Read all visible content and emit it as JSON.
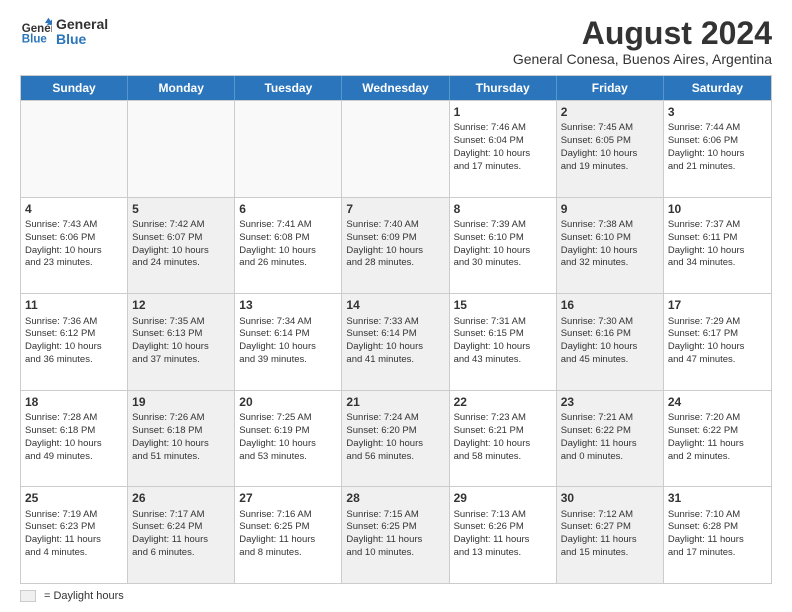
{
  "logo": {
    "line1": "General",
    "line2": "Blue"
  },
  "title": "August 2024",
  "subtitle": "General Conesa, Buenos Aires, Argentina",
  "days_of_week": [
    "Sunday",
    "Monday",
    "Tuesday",
    "Wednesday",
    "Thursday",
    "Friday",
    "Saturday"
  ],
  "weeks": [
    [
      {
        "day": "",
        "empty": true,
        "shaded": false,
        "lines": []
      },
      {
        "day": "",
        "empty": true,
        "shaded": false,
        "lines": []
      },
      {
        "day": "",
        "empty": true,
        "shaded": false,
        "lines": []
      },
      {
        "day": "",
        "empty": true,
        "shaded": false,
        "lines": []
      },
      {
        "day": "1",
        "empty": false,
        "shaded": false,
        "lines": [
          "Sunrise: 7:46 AM",
          "Sunset: 6:04 PM",
          "Daylight: 10 hours",
          "and 17 minutes."
        ]
      },
      {
        "day": "2",
        "empty": false,
        "shaded": true,
        "lines": [
          "Sunrise: 7:45 AM",
          "Sunset: 6:05 PM",
          "Daylight: 10 hours",
          "and 19 minutes."
        ]
      },
      {
        "day": "3",
        "empty": false,
        "shaded": false,
        "lines": [
          "Sunrise: 7:44 AM",
          "Sunset: 6:06 PM",
          "Daylight: 10 hours",
          "and 21 minutes."
        ]
      }
    ],
    [
      {
        "day": "4",
        "empty": false,
        "shaded": false,
        "lines": [
          "Sunrise: 7:43 AM",
          "Sunset: 6:06 PM",
          "Daylight: 10 hours",
          "and 23 minutes."
        ]
      },
      {
        "day": "5",
        "empty": false,
        "shaded": true,
        "lines": [
          "Sunrise: 7:42 AM",
          "Sunset: 6:07 PM",
          "Daylight: 10 hours",
          "and 24 minutes."
        ]
      },
      {
        "day": "6",
        "empty": false,
        "shaded": false,
        "lines": [
          "Sunrise: 7:41 AM",
          "Sunset: 6:08 PM",
          "Daylight: 10 hours",
          "and 26 minutes."
        ]
      },
      {
        "day": "7",
        "empty": false,
        "shaded": true,
        "lines": [
          "Sunrise: 7:40 AM",
          "Sunset: 6:09 PM",
          "Daylight: 10 hours",
          "and 28 minutes."
        ]
      },
      {
        "day": "8",
        "empty": false,
        "shaded": false,
        "lines": [
          "Sunrise: 7:39 AM",
          "Sunset: 6:10 PM",
          "Daylight: 10 hours",
          "and 30 minutes."
        ]
      },
      {
        "day": "9",
        "empty": false,
        "shaded": true,
        "lines": [
          "Sunrise: 7:38 AM",
          "Sunset: 6:10 PM",
          "Daylight: 10 hours",
          "and 32 minutes."
        ]
      },
      {
        "day": "10",
        "empty": false,
        "shaded": false,
        "lines": [
          "Sunrise: 7:37 AM",
          "Sunset: 6:11 PM",
          "Daylight: 10 hours",
          "and 34 minutes."
        ]
      }
    ],
    [
      {
        "day": "11",
        "empty": false,
        "shaded": false,
        "lines": [
          "Sunrise: 7:36 AM",
          "Sunset: 6:12 PM",
          "Daylight: 10 hours",
          "and 36 minutes."
        ]
      },
      {
        "day": "12",
        "empty": false,
        "shaded": true,
        "lines": [
          "Sunrise: 7:35 AM",
          "Sunset: 6:13 PM",
          "Daylight: 10 hours",
          "and 37 minutes."
        ]
      },
      {
        "day": "13",
        "empty": false,
        "shaded": false,
        "lines": [
          "Sunrise: 7:34 AM",
          "Sunset: 6:14 PM",
          "Daylight: 10 hours",
          "and 39 minutes."
        ]
      },
      {
        "day": "14",
        "empty": false,
        "shaded": true,
        "lines": [
          "Sunrise: 7:33 AM",
          "Sunset: 6:14 PM",
          "Daylight: 10 hours",
          "and 41 minutes."
        ]
      },
      {
        "day": "15",
        "empty": false,
        "shaded": false,
        "lines": [
          "Sunrise: 7:31 AM",
          "Sunset: 6:15 PM",
          "Daylight: 10 hours",
          "and 43 minutes."
        ]
      },
      {
        "day": "16",
        "empty": false,
        "shaded": true,
        "lines": [
          "Sunrise: 7:30 AM",
          "Sunset: 6:16 PM",
          "Daylight: 10 hours",
          "and 45 minutes."
        ]
      },
      {
        "day": "17",
        "empty": false,
        "shaded": false,
        "lines": [
          "Sunrise: 7:29 AM",
          "Sunset: 6:17 PM",
          "Daylight: 10 hours",
          "and 47 minutes."
        ]
      }
    ],
    [
      {
        "day": "18",
        "empty": false,
        "shaded": false,
        "lines": [
          "Sunrise: 7:28 AM",
          "Sunset: 6:18 PM",
          "Daylight: 10 hours",
          "and 49 minutes."
        ]
      },
      {
        "day": "19",
        "empty": false,
        "shaded": true,
        "lines": [
          "Sunrise: 7:26 AM",
          "Sunset: 6:18 PM",
          "Daylight: 10 hours",
          "and 51 minutes."
        ]
      },
      {
        "day": "20",
        "empty": false,
        "shaded": false,
        "lines": [
          "Sunrise: 7:25 AM",
          "Sunset: 6:19 PM",
          "Daylight: 10 hours",
          "and 53 minutes."
        ]
      },
      {
        "day": "21",
        "empty": false,
        "shaded": true,
        "lines": [
          "Sunrise: 7:24 AM",
          "Sunset: 6:20 PM",
          "Daylight: 10 hours",
          "and 56 minutes."
        ]
      },
      {
        "day": "22",
        "empty": false,
        "shaded": false,
        "lines": [
          "Sunrise: 7:23 AM",
          "Sunset: 6:21 PM",
          "Daylight: 10 hours",
          "and 58 minutes."
        ]
      },
      {
        "day": "23",
        "empty": false,
        "shaded": true,
        "lines": [
          "Sunrise: 7:21 AM",
          "Sunset: 6:22 PM",
          "Daylight: 11 hours",
          "and 0 minutes."
        ]
      },
      {
        "day": "24",
        "empty": false,
        "shaded": false,
        "lines": [
          "Sunrise: 7:20 AM",
          "Sunset: 6:22 PM",
          "Daylight: 11 hours",
          "and 2 minutes."
        ]
      }
    ],
    [
      {
        "day": "25",
        "empty": false,
        "shaded": false,
        "lines": [
          "Sunrise: 7:19 AM",
          "Sunset: 6:23 PM",
          "Daylight: 11 hours",
          "and 4 minutes."
        ]
      },
      {
        "day": "26",
        "empty": false,
        "shaded": true,
        "lines": [
          "Sunrise: 7:17 AM",
          "Sunset: 6:24 PM",
          "Daylight: 11 hours",
          "and 6 minutes."
        ]
      },
      {
        "day": "27",
        "empty": false,
        "shaded": false,
        "lines": [
          "Sunrise: 7:16 AM",
          "Sunset: 6:25 PM",
          "Daylight: 11 hours",
          "and 8 minutes."
        ]
      },
      {
        "day": "28",
        "empty": false,
        "shaded": true,
        "lines": [
          "Sunrise: 7:15 AM",
          "Sunset: 6:25 PM",
          "Daylight: 11 hours",
          "and 10 minutes."
        ]
      },
      {
        "day": "29",
        "empty": false,
        "shaded": false,
        "lines": [
          "Sunrise: 7:13 AM",
          "Sunset: 6:26 PM",
          "Daylight: 11 hours",
          "and 13 minutes."
        ]
      },
      {
        "day": "30",
        "empty": false,
        "shaded": true,
        "lines": [
          "Sunrise: 7:12 AM",
          "Sunset: 6:27 PM",
          "Daylight: 11 hours",
          "and 15 minutes."
        ]
      },
      {
        "day": "31",
        "empty": false,
        "shaded": false,
        "lines": [
          "Sunrise: 7:10 AM",
          "Sunset: 6:28 PM",
          "Daylight: 11 hours",
          "and 17 minutes."
        ]
      }
    ]
  ],
  "legend": {
    "shaded_label": "= Daylight hours"
  }
}
